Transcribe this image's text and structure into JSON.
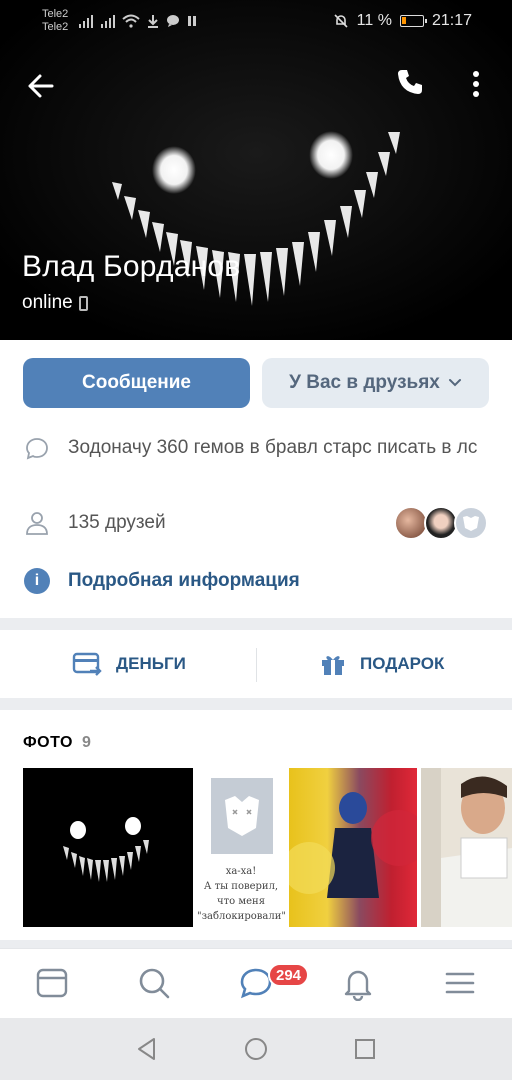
{
  "status_bar": {
    "carrier1": "Tele2",
    "carrier2": "Tele2",
    "battery_percent": "11 %",
    "time": "21:17"
  },
  "profile": {
    "name": "Влад Борданов",
    "online": "online"
  },
  "buttons": {
    "message": "Сообщение",
    "friends": "У Вас в друзьях"
  },
  "info": {
    "status": "Зодоначу 360 гемов в бравл старс писать в лс",
    "friends_count": "135 друзей",
    "details": "Подробная информация"
  },
  "actions": {
    "money": "ДЕНЬГИ",
    "gift": "ПОДАРОК"
  },
  "photos": {
    "title": "ФОТО",
    "count": "9",
    "blocked_caption": [
      "ха-ха!",
      "А ты поверил,",
      "что меня",
      "\"заблокировали\"!"
    ]
  },
  "tabbar": {
    "messages_badge": "294"
  },
  "colors": {
    "accent": "#5181b8",
    "link": "#2a5885",
    "badge": "#e64646"
  }
}
